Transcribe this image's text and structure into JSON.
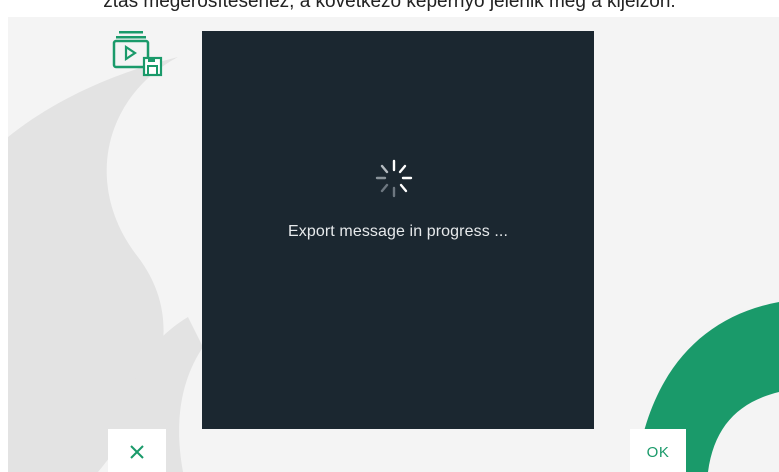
{
  "caption": {
    "text": "ztás megerősítéséhez, a következő képernyő jelenik meg a kijelzőn:"
  },
  "colors": {
    "accent": "#1a9a6a",
    "modal_bg": "#1b2730",
    "screen_bg": "#f4f4f4",
    "deco_gray": "#e0e0e0"
  },
  "header": {
    "icon": "video-message-save-icon"
  },
  "modal": {
    "spinner_icon": "loading-spinner-icon",
    "message": "Export message in progress ..."
  },
  "footer": {
    "cancel_icon": "close-icon",
    "ok_label": "OK"
  }
}
